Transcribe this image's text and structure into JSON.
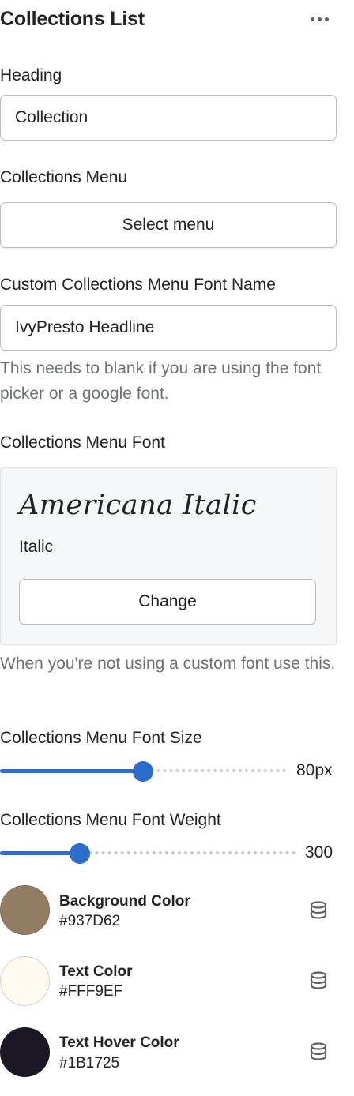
{
  "panel": {
    "title": "Collections List"
  },
  "heading": {
    "label": "Heading",
    "value": "Collection"
  },
  "collections_menu": {
    "label": "Collections Menu",
    "button": "Select menu"
  },
  "custom_font_name": {
    "label": "Custom Collections Menu Font Name",
    "value": "IvyPresto Headline",
    "help": "This needs to blank if you are using the font picker or a google font."
  },
  "menu_font": {
    "label": "Collections Menu Font",
    "preview": "Americana Italic",
    "style": "Italic",
    "change_button": "Change",
    "help": "When you're not using a custom font use this."
  },
  "font_size": {
    "label": "Collections Menu Font Size",
    "value_text": "80px",
    "fraction": 0.5
  },
  "font_weight": {
    "label": "Collections Menu Font Weight",
    "value_text": "300",
    "fraction": 0.27
  },
  "colors": [
    {
      "name": "Background Color",
      "hex": "#937D62",
      "swatch": "#937D62"
    },
    {
      "name": "Text Color",
      "hex": "#FFF9EF",
      "swatch": "#FFF9EF"
    },
    {
      "name": "Text Hover Color",
      "hex": "#1B1725",
      "swatch": "#1B1725"
    }
  ],
  "icons": {
    "more": "horizontal-dots",
    "dynamic_source": "database"
  }
}
